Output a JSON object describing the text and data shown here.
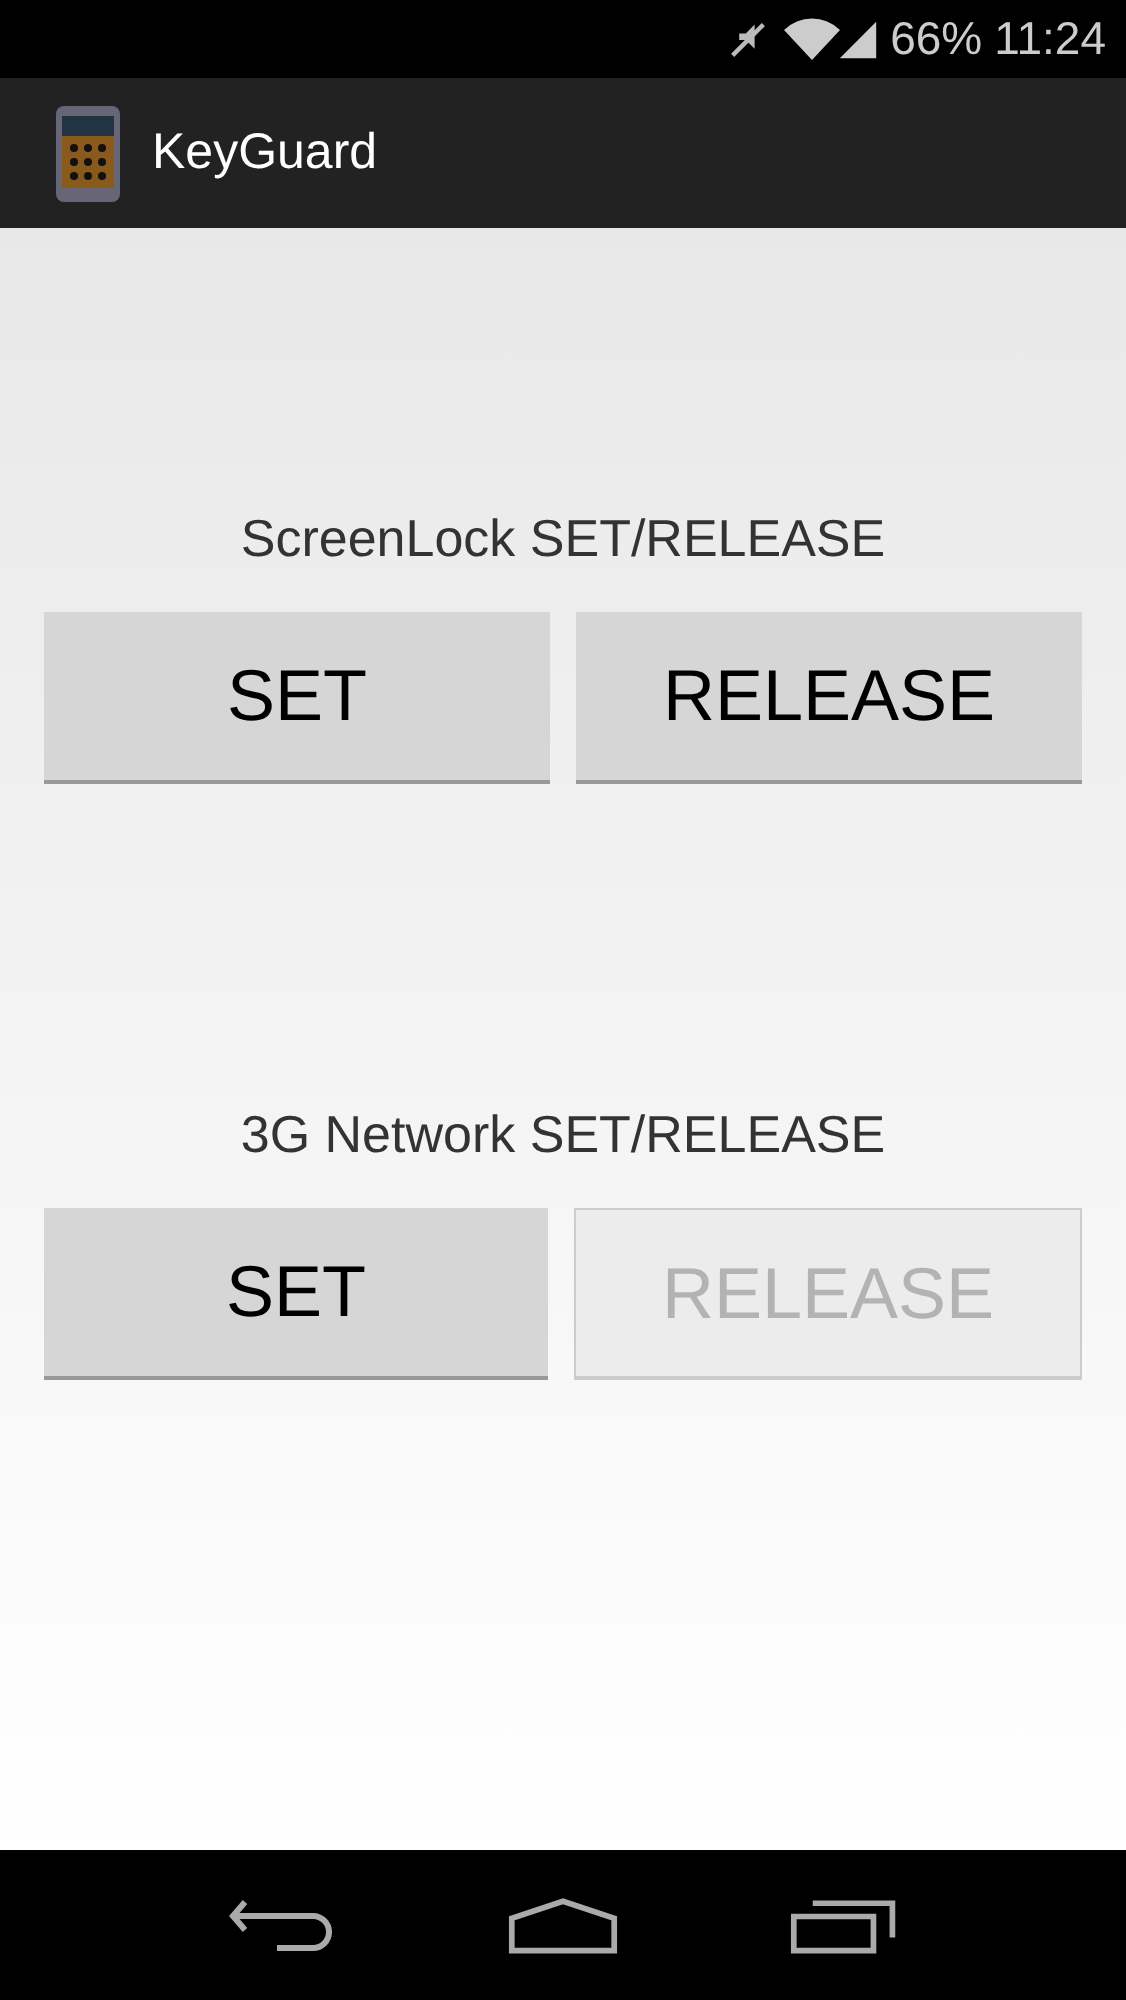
{
  "status_bar": {
    "battery": "66%",
    "time": "11:24"
  },
  "action_bar": {
    "title": "KeyGuard"
  },
  "sections": [
    {
      "label": "ScreenLock SET/RELEASE",
      "buttons": [
        {
          "label": "SET",
          "disabled": false
        },
        {
          "label": "RELEASE",
          "disabled": false
        }
      ]
    },
    {
      "label": "3G Network SET/RELEASE",
      "buttons": [
        {
          "label": "SET",
          "disabled": false
        },
        {
          "label": "RELEASE",
          "disabled": true
        }
      ]
    }
  ]
}
